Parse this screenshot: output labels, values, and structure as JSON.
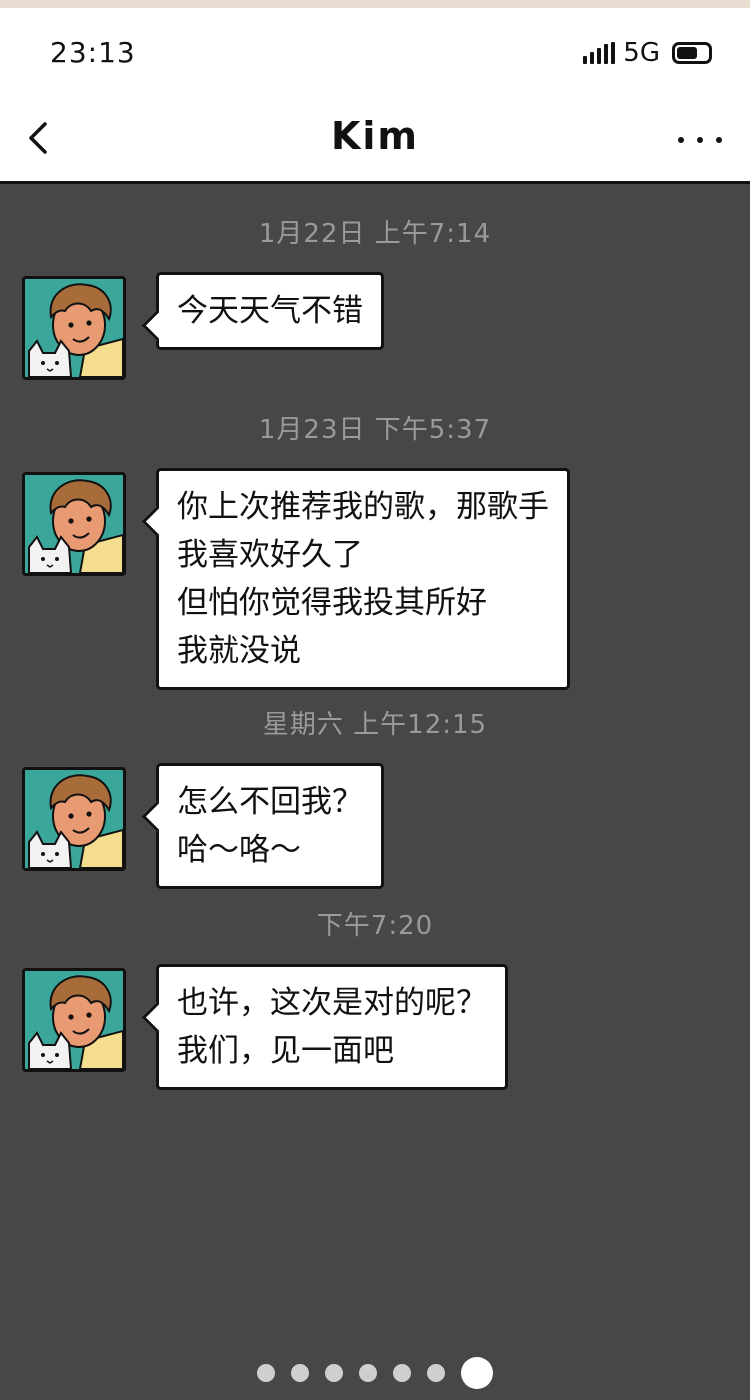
{
  "status_bar": {
    "time": "23:13",
    "network": "5G"
  },
  "header": {
    "title": "Kim"
  },
  "messages": [
    {
      "timestamp": "1月22日 上午7:14",
      "text": "今天天气不错"
    },
    {
      "timestamp": "1月23日 下午5:37",
      "text": "你上次推荐我的歌，那歌手\n我喜欢好久了\n但怕你觉得我投其所好\n我就没说"
    },
    {
      "timestamp": "星期六 上午12:15",
      "text": "怎么不回我？\n哈～咯～"
    },
    {
      "timestamp": "下午7:20",
      "text": "也许，这次是对的呢？\n我们，见一面吧"
    }
  ],
  "pager": {
    "total": 7,
    "active_index": 6
  }
}
